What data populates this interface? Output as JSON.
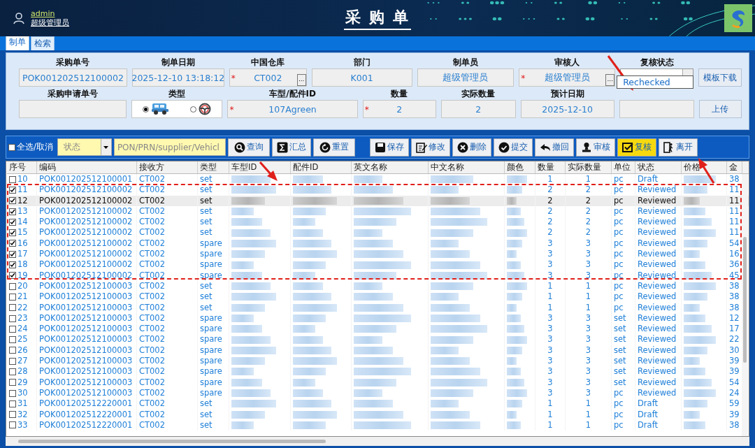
{
  "header": {
    "user": {
      "name": "admin",
      "role": "超级管理员"
    },
    "title": "采 购 单"
  },
  "tabs": [
    {
      "label": "制单",
      "selected": true
    },
    {
      "label": "检索",
      "selected": false
    }
  ],
  "form": {
    "rows": [
      {
        "fields": [
          {
            "kind": "text",
            "label": "采购单号",
            "value": "POK001202512100002"
          },
          {
            "kind": "text",
            "label": "制单日期",
            "value": "2025-12-10 13:18:12"
          },
          {
            "kind": "text",
            "label": "中国仓库",
            "value": "CT002",
            "required_mark": "*",
            "picker_label": "..."
          },
          {
            "kind": "text",
            "label": "部门",
            "value": "K001"
          },
          {
            "kind": "text",
            "label": "制单员",
            "value": "超级管理员"
          },
          {
            "kind": "text",
            "label": "审核人",
            "value": "超级管理员",
            "required_mark": "*",
            "picker_label": "..."
          },
          {
            "kind": "dropdown",
            "label": "复核状态",
            "options": [
              "Rechecked"
            ]
          }
        ],
        "button": "模板下载"
      },
      {
        "fields": [
          {
            "kind": "text",
            "label": "采购申请单号"
          },
          {
            "kind": "radio",
            "label": "类型",
            "options": [
              {
                "kind": "car",
                "selected": true
              },
              {
                "kind": "wheel",
                "selected": false
              }
            ]
          },
          {
            "kind": "text",
            "label": "车型/配件ID",
            "value": "107Agreen",
            "required_mark": "*"
          },
          {
            "kind": "text",
            "label": "数量",
            "value": "2",
            "required_mark": "*"
          },
          {
            "kind": "text",
            "label": "实际数量",
            "value": "2"
          },
          {
            "kind": "text",
            "label": "预计日期",
            "value": "2025-12-10"
          },
          {
            "kind": "text"
          }
        ],
        "button": "上传"
      }
    ]
  },
  "toolbar": {
    "select_all": {
      "label": "全选/取消",
      "checked": false
    },
    "status_filter": {
      "placeholder": "状态"
    },
    "search": {
      "placeholder": "PON/PRN/supplier/Vehicl"
    },
    "query_buttons": [
      {
        "kind": "search",
        "label": "查询",
        "highlighted": false
      },
      {
        "kind": "sum",
        "label": "汇总",
        "highlighted": false
      },
      {
        "kind": "reset",
        "label": "重置",
        "highlighted": false
      }
    ],
    "action_buttons": [
      {
        "kind": "save",
        "label": "保存",
        "highlighted": false
      },
      {
        "kind": "edit",
        "label": "修改",
        "highlighted": false
      },
      {
        "kind": "delete",
        "label": "删除",
        "highlighted": false
      },
      {
        "kind": "submit",
        "label": "提交",
        "highlighted": false
      },
      {
        "kind": "undo",
        "label": "撤回",
        "highlighted": false
      },
      {
        "kind": "audit",
        "label": "审核",
        "highlighted": false
      },
      {
        "kind": "recheck",
        "label": "复核",
        "highlighted": true
      },
      {
        "kind": "exit",
        "label": "离开",
        "highlighted": false
      }
    ]
  },
  "table": {
    "columns": [
      "序号",
      "编码",
      "接收方",
      "类型",
      "车型ID",
      "配件ID",
      "英文名称",
      "中文名称",
      "颜色",
      "数量",
      "实际数量",
      "单位",
      "状态",
      "价格",
      "金"
    ],
    "rows": [
      {
        "no": "10",
        "code": "POK001202512100001",
        "receiver": "CT002",
        "type": "set",
        "qty": "1",
        "actual_qty": "1",
        "unit": "pc",
        "status": "Draft",
        "amount": "38",
        "checked": false,
        "selected": false
      },
      {
        "no": "11",
        "code": "POK001202512100002",
        "receiver": "CT002",
        "type": "set",
        "qty": "2",
        "actual_qty": "2",
        "unit": "pc",
        "status": "Reviewed",
        "amount": "11",
        "checked": true,
        "selected": false
      },
      {
        "no": "12",
        "code": "POK001202512100002",
        "receiver": "CT002",
        "type": "set",
        "qty": "2",
        "actual_qty": "2",
        "unit": "pc",
        "status": "Reviewed",
        "amount": "11",
        "checked": true,
        "selected": true
      },
      {
        "no": "13",
        "code": "POK001202512100002",
        "receiver": "CT002",
        "type": "set",
        "qty": "2",
        "actual_qty": "2",
        "unit": "pc",
        "status": "Reviewed",
        "amount": "11",
        "checked": true,
        "selected": false
      },
      {
        "no": "14",
        "code": "POK001202512100002",
        "receiver": "CT002",
        "type": "set",
        "qty": "2",
        "actual_qty": "2",
        "unit": "pc",
        "status": "Reviewed",
        "amount": "11",
        "checked": true,
        "selected": false
      },
      {
        "no": "15",
        "code": "POK001202512100002",
        "receiver": "CT002",
        "type": "set",
        "qty": "2",
        "actual_qty": "2",
        "unit": "pc",
        "status": "Reviewed",
        "amount": "11",
        "checked": true,
        "selected": false
      },
      {
        "no": "16",
        "code": "POK001202512100002",
        "receiver": "CT002",
        "type": "spare",
        "qty": "3",
        "actual_qty": "3",
        "unit": "pc",
        "status": "Reviewed",
        "amount": "54",
        "checked": true,
        "selected": false
      },
      {
        "no": "17",
        "code": "POK001202512100002",
        "receiver": "CT002",
        "type": "spare",
        "qty": "3",
        "actual_qty": "3",
        "unit": "pc",
        "status": "Reviewed",
        "amount": "16",
        "checked": true,
        "selected": false
      },
      {
        "no": "18",
        "code": "POK001202512100002",
        "receiver": "CT002",
        "type": "spare",
        "qty": "3",
        "actual_qty": "3",
        "unit": "pc",
        "status": "Reviewed",
        "amount": "36",
        "checked": true,
        "selected": false
      },
      {
        "no": "19",
        "code": "POK001202512100002",
        "receiver": "CT002",
        "type": "spare",
        "qty": "3",
        "actual_qty": "3",
        "unit": "pc",
        "status": "Reviewed",
        "amount": "45",
        "checked": true,
        "selected": false
      },
      {
        "no": "20",
        "code": "POK001202512100003",
        "receiver": "CT002",
        "type": "set",
        "qty": "1",
        "actual_qty": "1",
        "unit": "pc",
        "status": "Reviewed",
        "amount": "38",
        "checked": false,
        "selected": false
      },
      {
        "no": "21",
        "code": "POK001202512100003",
        "receiver": "CT002",
        "type": "set",
        "qty": "1",
        "actual_qty": "1",
        "unit": "pc",
        "status": "Reviewed",
        "amount": "38",
        "checked": false,
        "selected": false
      },
      {
        "no": "22",
        "code": "POK001202512100003",
        "receiver": "CT002",
        "type": "set",
        "qty": "1",
        "actual_qty": "1",
        "unit": "pc",
        "status": "Reviewed",
        "amount": "38",
        "checked": false,
        "selected": false
      },
      {
        "no": "23",
        "code": "POK001202512100003",
        "receiver": "CT002",
        "type": "spare",
        "qty": "3",
        "actual_qty": "3",
        "unit": "set",
        "status": "Reviewed",
        "amount": "12",
        "checked": false,
        "selected": false
      },
      {
        "no": "24",
        "code": "POK001202512100003",
        "receiver": "CT002",
        "type": "spare",
        "qty": "3",
        "actual_qty": "3",
        "unit": "set",
        "status": "Reviewed",
        "amount": "17",
        "checked": false,
        "selected": false
      },
      {
        "no": "25",
        "code": "POK001202512100003",
        "receiver": "CT002",
        "type": "spare",
        "qty": "3",
        "actual_qty": "3",
        "unit": "set",
        "status": "Reviewed",
        "amount": "22",
        "checked": false,
        "selected": false
      },
      {
        "no": "26",
        "code": "POK001202512100003",
        "receiver": "CT002",
        "type": "spare",
        "qty": "3",
        "actual_qty": "3",
        "unit": "set",
        "status": "Reviewed",
        "amount": "30",
        "checked": false,
        "selected": false
      },
      {
        "no": "27",
        "code": "POK001202512100003",
        "receiver": "CT002",
        "type": "spare",
        "qty": "3",
        "actual_qty": "3",
        "unit": "set",
        "status": "Reviewed",
        "amount": "39",
        "checked": false,
        "selected": false
      },
      {
        "no": "28",
        "code": "POK001202512100003",
        "receiver": "CT002",
        "type": "spare",
        "qty": "3",
        "actual_qty": "3",
        "unit": "set",
        "status": "Reviewed",
        "amount": "39",
        "checked": false,
        "selected": false
      },
      {
        "no": "29",
        "code": "POK001202512100003",
        "receiver": "CT002",
        "type": "spare",
        "qty": "3",
        "actual_qty": "3",
        "unit": "set",
        "status": "Reviewed",
        "amount": "54",
        "checked": false,
        "selected": false
      },
      {
        "no": "30",
        "code": "POK001202512100003",
        "receiver": "CT002",
        "type": "spare",
        "qty": "3",
        "actual_qty": "3",
        "unit": "pc",
        "status": "Reviewed",
        "amount": "24",
        "checked": false,
        "selected": false
      },
      {
        "no": "31",
        "code": "POK001202512220001",
        "receiver": "CT002",
        "type": "set",
        "qty": "1",
        "actual_qty": "1",
        "unit": "pc",
        "status": "Draft",
        "amount": "59",
        "checked": false,
        "selected": false
      },
      {
        "no": "32",
        "code": "POK001202512220001",
        "receiver": "CT002",
        "type": "set",
        "qty": "1",
        "actual_qty": "1",
        "unit": "pc",
        "status": "Draft",
        "amount": "39",
        "checked": false,
        "selected": false
      },
      {
        "no": "33",
        "code": "POK001202512220001",
        "receiver": "CT002",
        "type": "set",
        "qty": "1",
        "actual_qty": "1",
        "unit": "pc",
        "status": "Draft",
        "amount": "38",
        "checked": false,
        "selected": false
      }
    ]
  }
}
